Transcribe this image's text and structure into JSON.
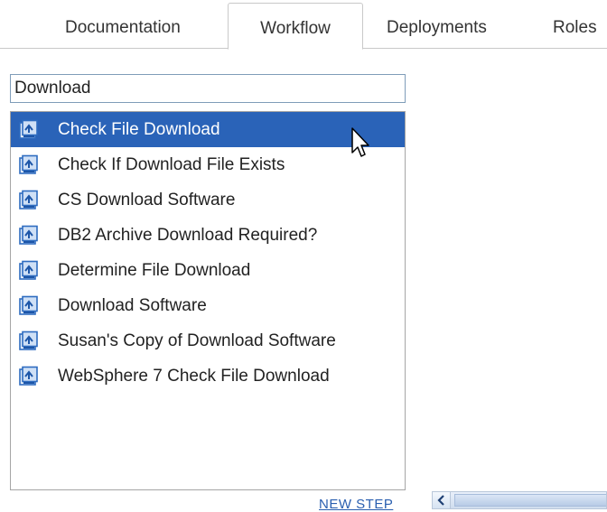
{
  "tabs": [
    {
      "label": "Documentation"
    },
    {
      "label": "Workflow",
      "active": true
    },
    {
      "label": "Deployments"
    },
    {
      "label": "Roles"
    }
  ],
  "search": {
    "value": "Download"
  },
  "results": [
    {
      "label": "Check File Download",
      "selected": true
    },
    {
      "label": "Check If Download File Exists"
    },
    {
      "label": "CS Download Software"
    },
    {
      "label": "DB2 Archive Download Required?"
    },
    {
      "label": "Determine File Download"
    },
    {
      "label": "Download Software"
    },
    {
      "label": "Susan's Copy of Download Software"
    },
    {
      "label": "WebSphere 7 Check File Download"
    }
  ],
  "footer": {
    "new_step_label": "NEW STEP"
  },
  "icons": {
    "result_item": "workflow-step-icon",
    "scroll_left": "chevron-left-icon",
    "cursor": "mouse-pointer-icon"
  },
  "colors": {
    "selection": "#2a63b8",
    "link": "#2a5fb0"
  }
}
